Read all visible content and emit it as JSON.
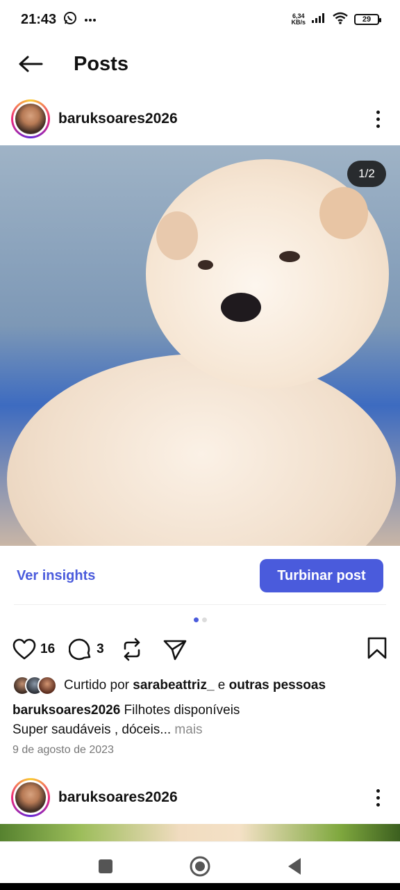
{
  "status_bar": {
    "time": "21:43",
    "net_speed_value": "6,34",
    "net_speed_unit": "KB/s",
    "battery": "29"
  },
  "header": {
    "title": "Posts"
  },
  "post": {
    "username": "baruksoares2026",
    "image_counter": "1/2",
    "insights_label": "Ver insights",
    "boost_label": "Turbinar post",
    "likes_count": "16",
    "comments_count": "3",
    "liked_by_prefix": "Curtido por ",
    "liked_by_user": "sarabeattriz_",
    "liked_by_mid": " e ",
    "liked_by_others": "outras pessoas",
    "caption_user": "baruksoares2026",
    "caption_line1": " Filhotes disponíveis",
    "caption_line2": "Super saudáveis , dóceis...",
    "caption_more": " mais",
    "date": "9 de agosto de 2023",
    "carousel_total": 2,
    "carousel_active": 1
  },
  "next_post": {
    "username": "baruksoares2026"
  },
  "colors": {
    "accent": "#4a5bdc",
    "text": "#111111",
    "muted": "#777777"
  }
}
